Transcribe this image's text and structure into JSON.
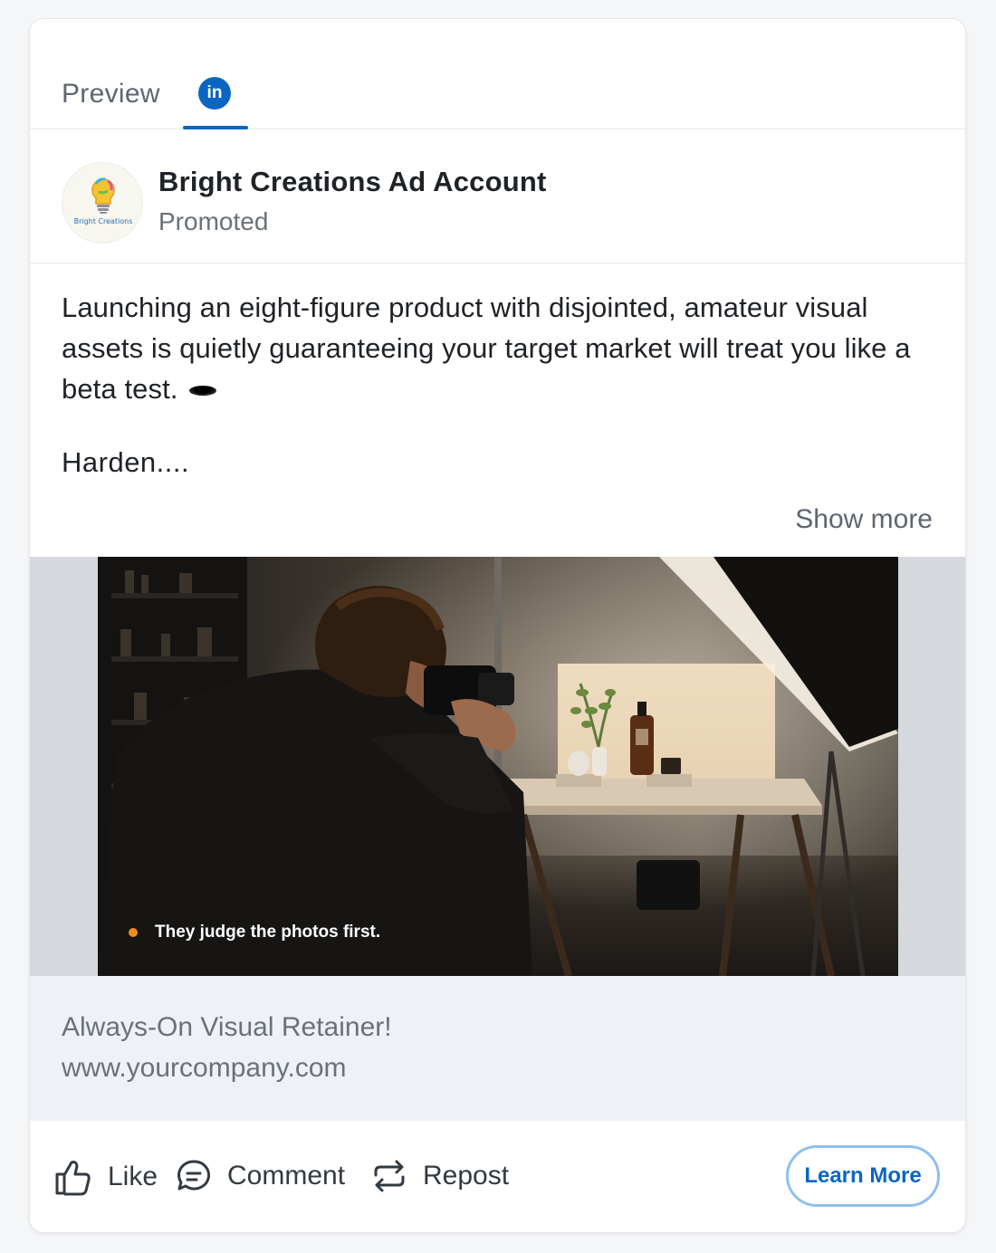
{
  "tabs": {
    "preview_label": "Preview",
    "active_network_icon": "linkedin-icon",
    "linkedin_glyph": "in"
  },
  "post": {
    "account_name": "Bright Creations Ad Account",
    "promoted_label": "Promoted",
    "avatar_icon": "lightbulb-logo",
    "avatar_text": "Bright Creations",
    "body_text": "Launching an eight-figure product with disjointed, amateur visual assets is quietly guaranteeing your target market will treat you like a beta test.",
    "body_emoji": "hole-emoji",
    "truncated_text": "Harden....",
    "show_more_label": "Show more"
  },
  "media": {
    "caption": "They judge the photos first.",
    "caption_dot_color": "#f28c1b"
  },
  "link": {
    "title": "Always-On Visual Retainer!",
    "url": "www.yourcompany.com"
  },
  "actions": {
    "like_label": "Like",
    "comment_label": "Comment",
    "repost_label": "Repost",
    "cta_label": "Learn More"
  },
  "colors": {
    "brand": "#0a66c2",
    "cta_border": "#8fc0ef",
    "link_area_bg": "#eef2f6"
  }
}
